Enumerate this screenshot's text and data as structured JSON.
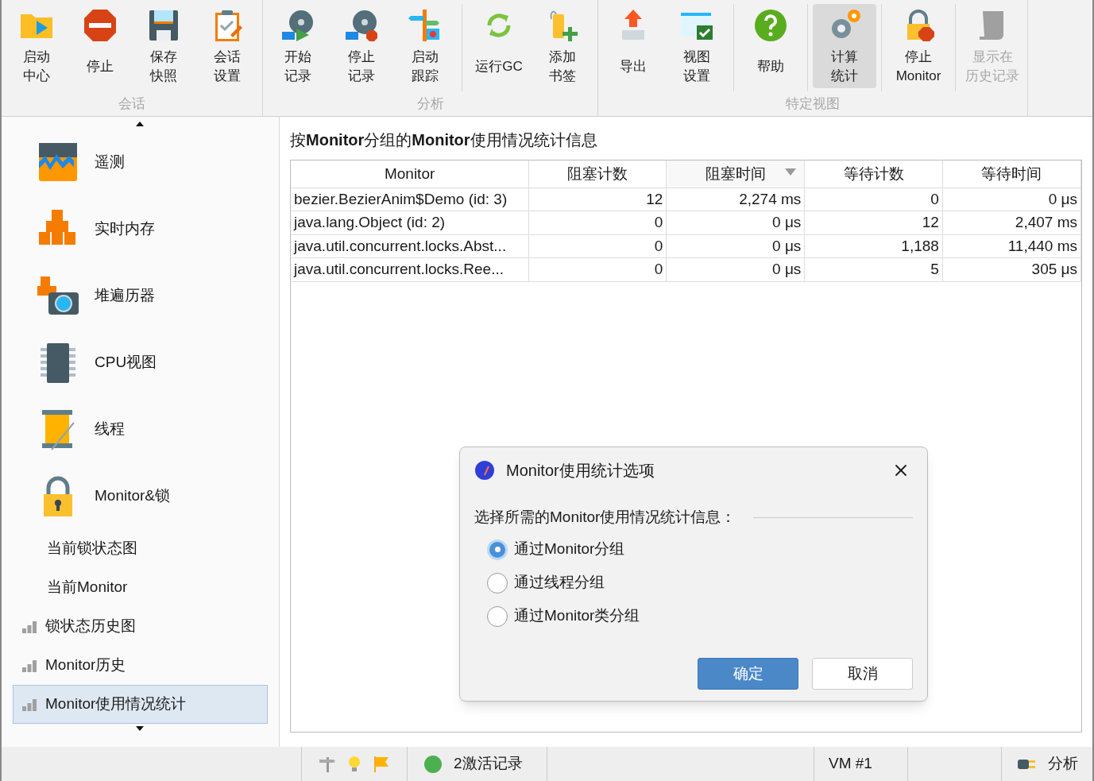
{
  "toolbar": {
    "groups": [
      {
        "label": "会话",
        "sections": [
          [
            {
              "lines": [
                "启动",
                "中心"
              ],
              "selected": false,
              "disabled": false
            },
            {
              "lines": [
                "停止"
              ],
              "selected": false,
              "disabled": false
            },
            {
              "lines": [
                "保存",
                "快照"
              ],
              "selected": false,
              "disabled": false
            },
            {
              "lines": [
                "会话",
                "设置"
              ],
              "selected": false,
              "disabled": false
            }
          ]
        ]
      },
      {
        "label": "分析",
        "sections": [
          [
            {
              "lines": [
                "开始",
                "记录"
              ],
              "selected": false,
              "disabled": false
            },
            {
              "lines": [
                "停止",
                "记录"
              ],
              "selected": false,
              "disabled": false
            },
            {
              "lines": [
                "启动",
                "跟踪"
              ],
              "selected": false,
              "disabled": false
            }
          ],
          [
            {
              "lines": [
                "运行GC"
              ],
              "selected": false,
              "disabled": false
            },
            {
              "lines": [
                "添加",
                "书签"
              ],
              "selected": false,
              "disabled": false
            }
          ]
        ]
      },
      {
        "label": "特定视图",
        "sections": [
          [
            {
              "lines": [
                "导出"
              ],
              "selected": false,
              "disabled": false
            },
            {
              "lines": [
                "视图",
                "设置"
              ],
              "selected": false,
              "disabled": false
            }
          ],
          [
            {
              "lines": [
                "帮助"
              ],
              "selected": false,
              "disabled": false
            }
          ],
          [
            {
              "lines": [
                "计算",
                "统计"
              ],
              "selected": true,
              "disabled": false
            }
          ],
          [
            {
              "lines": [
                "停止",
                "Monitor"
              ],
              "selected": false,
              "disabled": false
            }
          ],
          [
            {
              "lines": [
                "显示在",
                "历史记录"
              ],
              "selected": false,
              "disabled": true
            }
          ]
        ]
      }
    ]
  },
  "sidebar": {
    "items": [
      {
        "kind": "large",
        "label": "遥测",
        "selected": false
      },
      {
        "kind": "large",
        "label": "实时内存",
        "selected": false
      },
      {
        "kind": "large",
        "label": "堆遍历器",
        "selected": false
      },
      {
        "kind": "large",
        "label": "CPU视图",
        "selected": false
      },
      {
        "kind": "large",
        "label": "线程",
        "selected": false
      },
      {
        "kind": "large",
        "label": "Monitor&锁",
        "selected": false
      },
      {
        "kind": "sub",
        "label": "当前锁状态图",
        "selected": false
      },
      {
        "kind": "sub",
        "label": "当前Monitor",
        "selected": false
      },
      {
        "kind": "chart",
        "label": "锁状态历史图",
        "selected": false
      },
      {
        "kind": "chart",
        "label": "Monitor历史",
        "selected": false
      },
      {
        "kind": "chart",
        "label": "Monitor使用情况统计",
        "selected": true
      }
    ]
  },
  "view": {
    "title": "按**Monitor**分组的**Monitor**使用情况统计信息",
    "table": {
      "columns": [
        {
          "label": "Monitor",
          "sorted": false
        },
        {
          "label": "阻塞计数",
          "sorted": false
        },
        {
          "label": "阻塞时间",
          "sorted": true
        },
        {
          "label": "等待计数",
          "sorted": false
        },
        {
          "label": "等待时间",
          "sorted": false
        }
      ],
      "rows": [
        [
          "bezier.BezierAnim$Demo (id: 3)",
          "12",
          "2,274 ms",
          "0",
          "0 μs"
        ],
        [
          "java.lang.Object (id: 2)",
          "0",
          "0 μs",
          "12",
          "2,407 ms"
        ],
        [
          "java.util.concurrent.locks.Abst...",
          "0",
          "0 μs",
          "1,188",
          "11,440 ms"
        ],
        [
          "java.util.concurrent.locks.Ree...",
          "0",
          "0 μs",
          "5",
          "305 μs"
        ]
      ]
    }
  },
  "dialog": {
    "title": "Monitor使用统计选项",
    "prompt": "选择所需的Monitor使用情况统计信息：",
    "options": [
      {
        "label": "通过Monitor分组",
        "selected": true
      },
      {
        "label": "通过线程分组",
        "selected": false
      },
      {
        "label": "通过Monitor类分组",
        "selected": false
      }
    ],
    "buttons": [
      {
        "label": "确定",
        "kind": "primary"
      },
      {
        "label": "取消",
        "kind": "secondary"
      }
    ]
  },
  "status_bar": {
    "recordings": "2激活记录",
    "vm": "VM #1",
    "mode": "分析"
  }
}
